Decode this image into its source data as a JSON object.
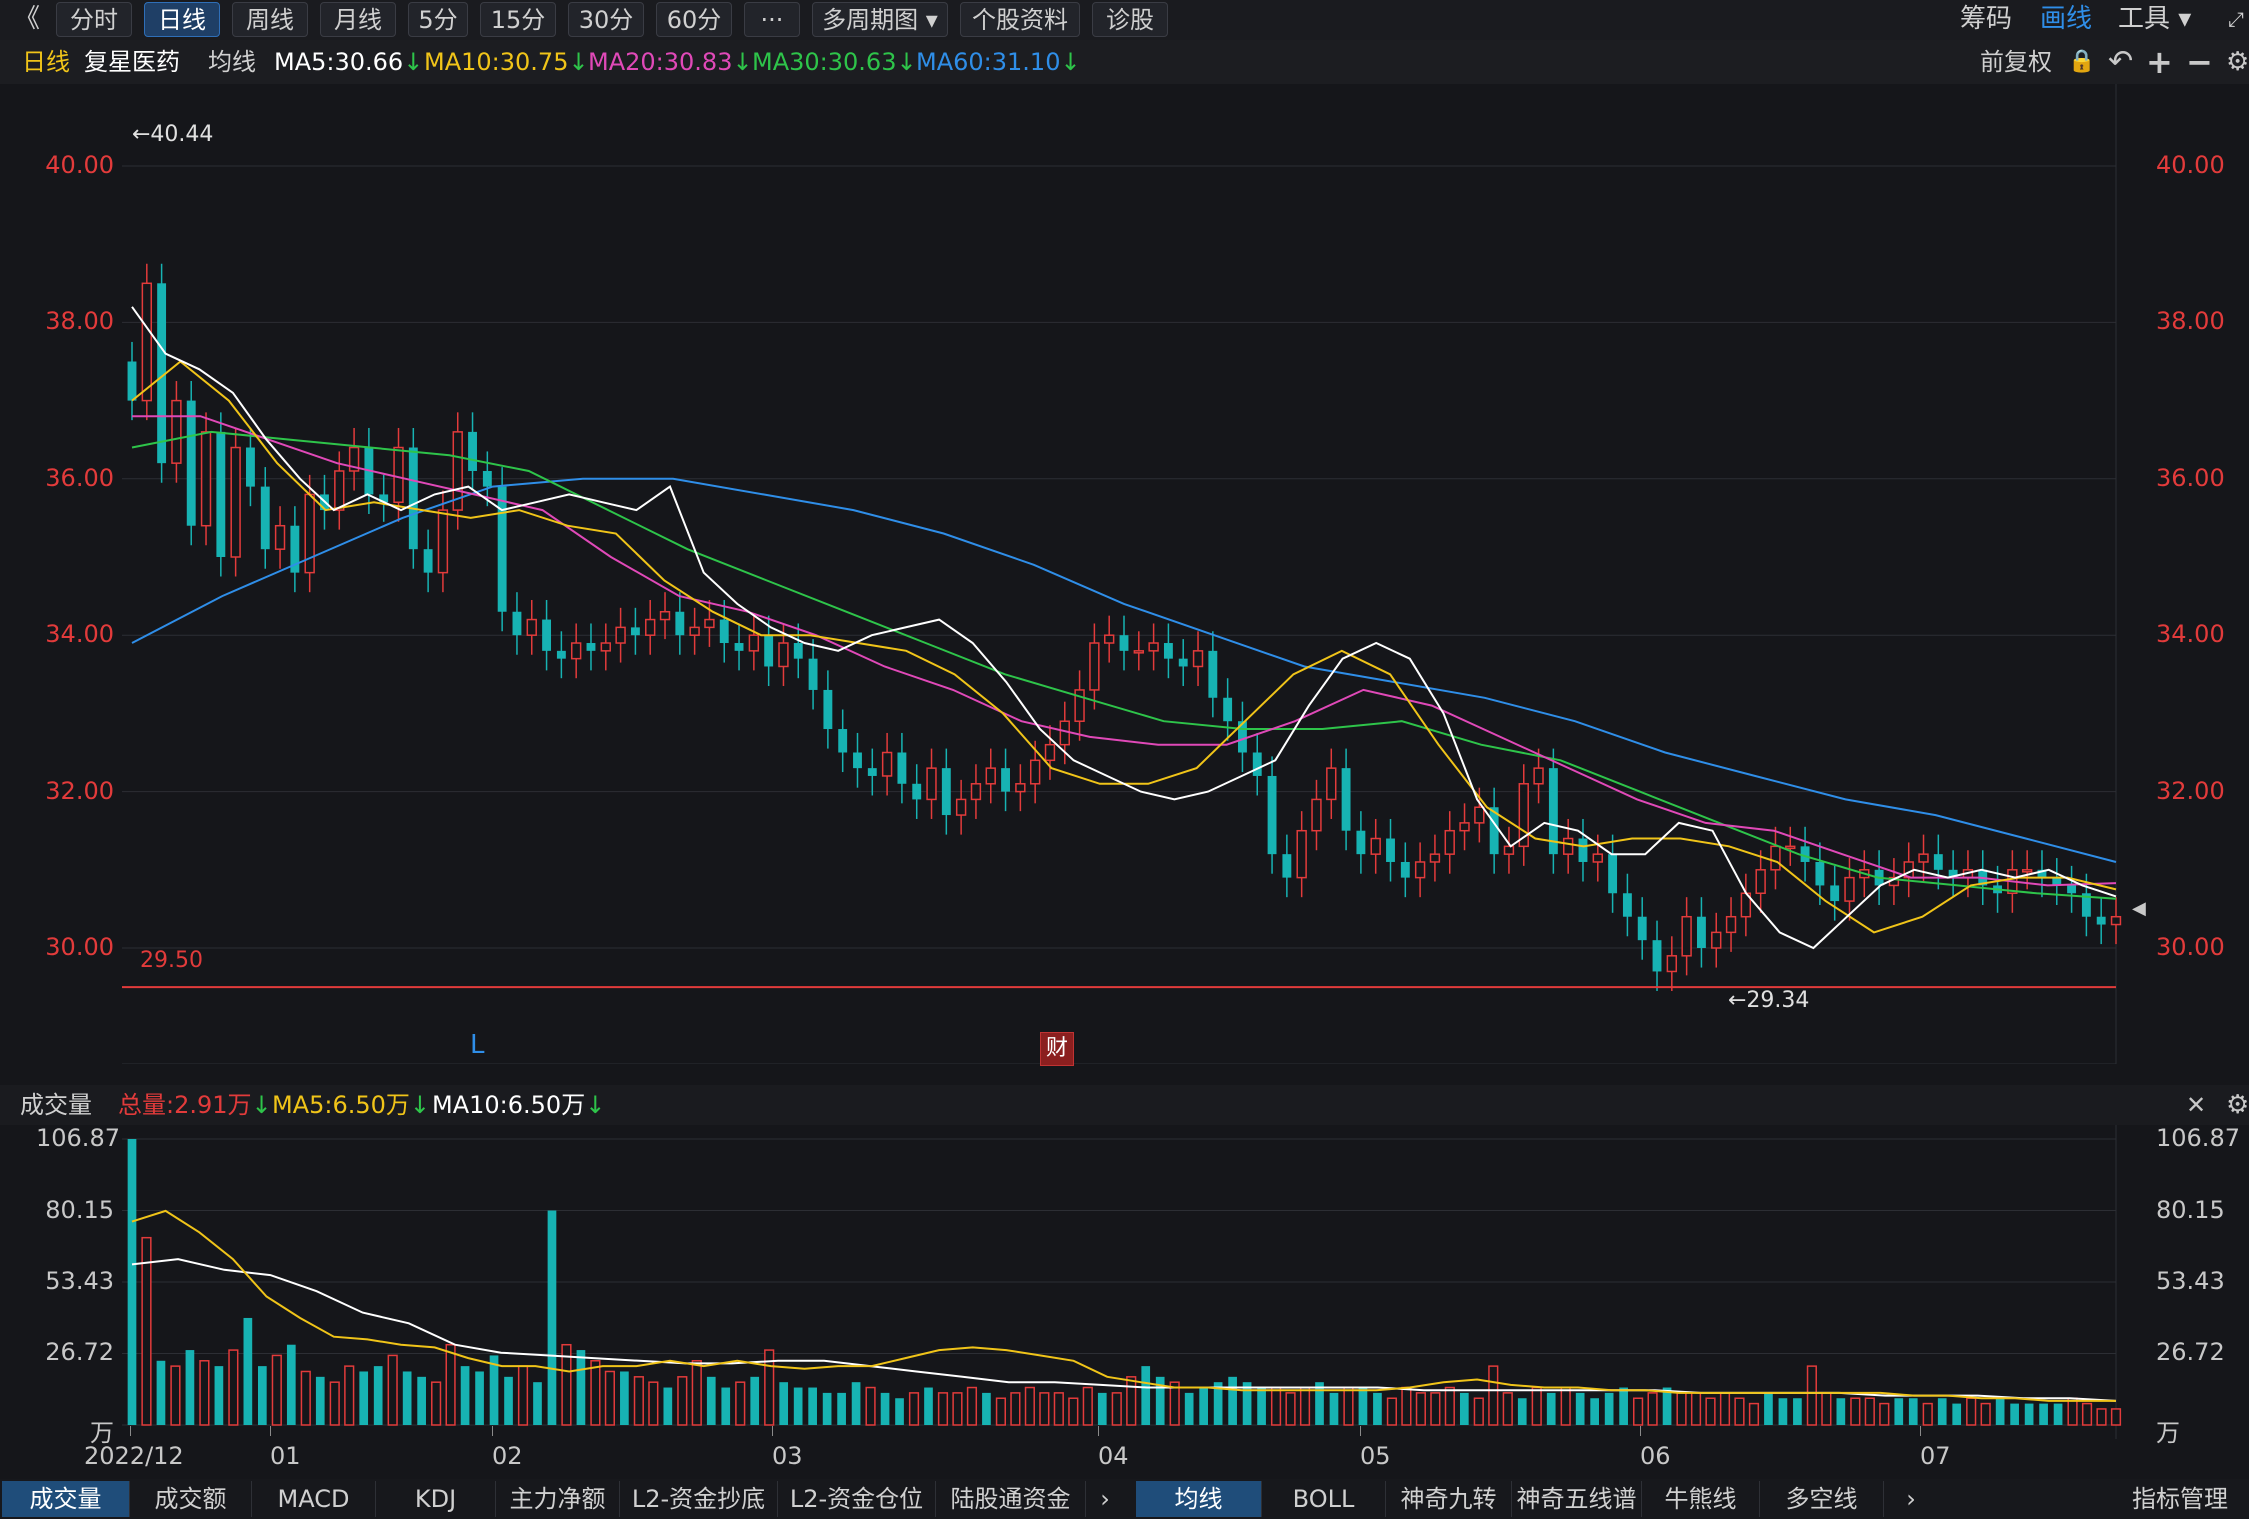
{
  "toolbar": {
    "back_label": "《",
    "tabs": [
      "分时",
      "日线",
      "周线",
      "月线",
      "5分",
      "15分",
      "30分",
      "60分",
      "···",
      "多周期图 ▾",
      "个股资料",
      "诊股"
    ],
    "right": {
      "chips": "筹码",
      "draw": "画线",
      "tools": "工具 ▾",
      "expand": "⤢"
    }
  },
  "ma_bar": {
    "period": "日线",
    "name": "复星医药",
    "avg_label": "均线",
    "ma5": "MA5:30.66",
    "ma10": "MA10:30.75",
    "ma20": "MA20:30.83",
    "ma30": "MA30:30.63",
    "ma60": "MA60:31.10",
    "arrow": "↓",
    "adjust": "前复权",
    "lock": "🔒",
    "undo": "↶",
    "plus": "+",
    "minus": "−",
    "gear": "⚙"
  },
  "price_axis": [
    "40.00",
    "38.00",
    "36.00",
    "34.00",
    "32.00",
    "30.00"
  ],
  "volume_axis": [
    "106.87",
    "80.15",
    "53.43",
    "26.72",
    "万"
  ],
  "x_axis": [
    "2022/12",
    "01",
    "02",
    "03",
    "04",
    "05",
    "06",
    "07"
  ],
  "annotations": {
    "high": "←40.44",
    "low": "←29.34",
    "line_value": "29.50",
    "L_marker": "L",
    "cai": "财"
  },
  "volume_bar": {
    "label": "成交量",
    "total": "总量:2.91万",
    "ma5": "MA5:6.50万",
    "ma10": "MA10:6.50万",
    "arrow": "↓",
    "close": "✕",
    "gear": "⚙"
  },
  "bottom_tabs": [
    "成交量",
    "成交额",
    "MACD",
    "KDJ",
    "主力净额",
    "L2-资金抄底",
    "L2-资金仓位",
    "陆股通资金"
  ],
  "bottom_tabs2": [
    "均线",
    "BOLL",
    "神奇九转",
    "神奇五线谱",
    "牛熊线",
    "多空线"
  ],
  "bottom_right": {
    "more": "›",
    "more2": "›",
    "manage": "指标管理"
  },
  "colors": {
    "up": "#e23b3b",
    "down": "#17b3b3",
    "ma5": "#ffffff",
    "ma10": "#f0c419",
    "ma20": "#e049b8",
    "ma30": "#2ec44a",
    "ma60": "#2f8ee8"
  },
  "chart_data": {
    "type": "line",
    "title": "",
    "xlabel": "",
    "ylabel": "",
    "ylim": [
      29.0,
      40.6
    ],
    "volume_ylim": [
      0,
      106.87
    ],
    "months": [
      "2022/12",
      "01",
      "02",
      "03",
      "04",
      "05",
      "06",
      "07"
    ],
    "close": [
      37.0,
      38.5,
      36.2,
      37.0,
      35.4,
      36.6,
      35.0,
      36.4,
      35.9,
      35.1,
      35.4,
      34.8,
      35.8,
      35.6,
      36.1,
      36.4,
      35.8,
      35.7,
      36.4,
      35.1,
      34.8,
      35.6,
      36.6,
      36.1,
      35.9,
      34.3,
      34.0,
      34.2,
      33.8,
      33.7,
      33.9,
      33.8,
      33.9,
      34.1,
      34.0,
      34.2,
      34.3,
      34.0,
      34.1,
      34.2,
      33.9,
      33.8,
      34.0,
      33.6,
      33.9,
      33.7,
      33.3,
      32.8,
      32.5,
      32.3,
      32.2,
      32.5,
      32.1,
      31.9,
      32.3,
      31.7,
      31.9,
      32.1,
      32.3,
      32.0,
      32.1,
      32.4,
      32.6,
      32.9,
      33.3,
      33.9,
      34.0,
      33.8,
      33.8,
      33.9,
      33.7,
      33.6,
      33.8,
      33.2,
      32.9,
      32.5,
      32.2,
      31.2,
      30.9,
      31.5,
      31.9,
      32.3,
      31.5,
      31.2,
      31.4,
      31.1,
      30.9,
      31.1,
      31.2,
      31.5,
      31.6,
      31.8,
      31.2,
      31.3,
      32.1,
      32.3,
      31.2,
      31.4,
      31.1,
      31.2,
      30.7,
      30.4,
      30.1,
      29.7,
      29.9,
      30.4,
      30.0,
      30.2,
      30.4,
      30.7,
      31.0,
      31.3,
      31.3,
      31.1,
      30.8,
      30.6,
      30.9,
      31.0,
      30.8,
      30.9,
      31.1,
      31.2,
      31.0,
      30.9,
      31.0,
      30.8,
      30.7,
      31.0,
      31.0,
      30.9,
      30.8,
      30.7,
      30.4,
      30.3,
      30.4
    ],
    "ma5": [
      38.2,
      37.6,
      37.4,
      37.1,
      36.5,
      36.0,
      35.6,
      35.8,
      35.6,
      35.8,
      35.9,
      35.6,
      35.7,
      35.8,
      35.7,
      35.6,
      35.9,
      34.8,
      34.4,
      34.1,
      33.9,
      33.8,
      34.0,
      34.1,
      34.2,
      33.9,
      33.4,
      32.8,
      32.4,
      32.2,
      32.0,
      31.9,
      32.0,
      32.2,
      32.4,
      33.1,
      33.7,
      33.9,
      33.7,
      33.0,
      31.9,
      31.3,
      31.6,
      31.5,
      31.2,
      31.2,
      31.6,
      31.5,
      30.7,
      30.2,
      30.0,
      30.4,
      30.8,
      31.0,
      30.9,
      31.0,
      30.9,
      31.0,
      30.8,
      30.66
    ],
    "ma10": [
      37.0,
      37.5,
      37.0,
      36.2,
      35.6,
      35.7,
      35.6,
      35.5,
      35.6,
      35.4,
      35.3,
      34.7,
      34.3,
      34.0,
      34.0,
      33.9,
      33.8,
      33.5,
      33.0,
      32.3,
      32.1,
      32.1,
      32.3,
      32.9,
      33.5,
      33.8,
      33.5,
      32.6,
      31.8,
      31.4,
      31.3,
      31.4,
      31.4,
      31.3,
      31.1,
      30.6,
      30.2,
      30.4,
      30.8,
      30.9,
      30.9,
      30.75
    ],
    "ma20": [
      36.8,
      36.8,
      36.5,
      36.2,
      36.0,
      35.8,
      35.6,
      35.0,
      34.5,
      34.3,
      34.0,
      33.6,
      33.3,
      32.9,
      32.7,
      32.6,
      32.6,
      32.9,
      33.3,
      33.1,
      32.7,
      32.3,
      31.9,
      31.6,
      31.5,
      31.2,
      30.9,
      30.9,
      30.8,
      30.83
    ],
    "ma30": [
      36.4,
      36.6,
      36.5,
      36.4,
      36.3,
      36.1,
      35.6,
      35.1,
      34.7,
      34.3,
      33.9,
      33.5,
      33.2,
      32.9,
      32.8,
      32.8,
      32.9,
      32.6,
      32.4,
      32.0,
      31.6,
      31.2,
      30.9,
      30.8,
      30.7,
      30.63
    ],
    "ma60": [
      33.9,
      34.5,
      35.0,
      35.5,
      35.9,
      36.0,
      36.0,
      35.8,
      35.6,
      35.3,
      34.9,
      34.4,
      34.0,
      33.6,
      33.4,
      33.2,
      32.9,
      32.5,
      32.2,
      31.9,
      31.7,
      31.4,
      31.1
    ],
    "volume": [
      106.87,
      70,
      24,
      22,
      28,
      24,
      22,
      28,
      40,
      22,
      26,
      30,
      20,
      18,
      16,
      22,
      20,
      22,
      26,
      20,
      18,
      16,
      30,
      22,
      20,
      26,
      18,
      22,
      16,
      80.15,
      30,
      28,
      24,
      20,
      20,
      18,
      16,
      14,
      18,
      24,
      18,
      14,
      16,
      18,
      28,
      16,
      14,
      14,
      12,
      12,
      16,
      14,
      12,
      10,
      12,
      14,
      12,
      12,
      14,
      12,
      10,
      12,
      14,
      12,
      12,
      10,
      14,
      12,
      12,
      18,
      22,
      18,
      16,
      12,
      14,
      16,
      18,
      16,
      14,
      14,
      12,
      14,
      16,
      12,
      14,
      14,
      12,
      10,
      14,
      12,
      12,
      14,
      12,
      10,
      22,
      12,
      10,
      14,
      12,
      14,
      12,
      10,
      12,
      14,
      10,
      12,
      14,
      12,
      12,
      10,
      12,
      10,
      8,
      12,
      10,
      10,
      22,
      12,
      10,
      10,
      10,
      8,
      10,
      10,
      8,
      10,
      8,
      10,
      8,
      10,
      8,
      8,
      8,
      8,
      10,
      8,
      6,
      6
    ],
    "volume_ma5": [
      76,
      80,
      72,
      62,
      48,
      40,
      33,
      32,
      30,
      29,
      25,
      22,
      22,
      20,
      22,
      22,
      24,
      22,
      24,
      22,
      21,
      22,
      22,
      25,
      28,
      29,
      28,
      26,
      24,
      18,
      16,
      14,
      14,
      13,
      13,
      13,
      13,
      13,
      14,
      16,
      17,
      15,
      14,
      14,
      13,
      13,
      12,
      12,
      12,
      12,
      12,
      12,
      12,
      11,
      11,
      10,
      10,
      9,
      9,
      9
    ],
    "volume_ma10": [
      60,
      62,
      58,
      56,
      50,
      42,
      38,
      30,
      27,
      26,
      25,
      24,
      23,
      23,
      24,
      24,
      22,
      20,
      18,
      16,
      16,
      15,
      14,
      14,
      14,
      14,
      14,
      14,
      13,
      13,
      13,
      13,
      13,
      13,
      12,
      12,
      12,
      12,
      11,
      11,
      11,
      10,
      10,
      9
    ]
  }
}
